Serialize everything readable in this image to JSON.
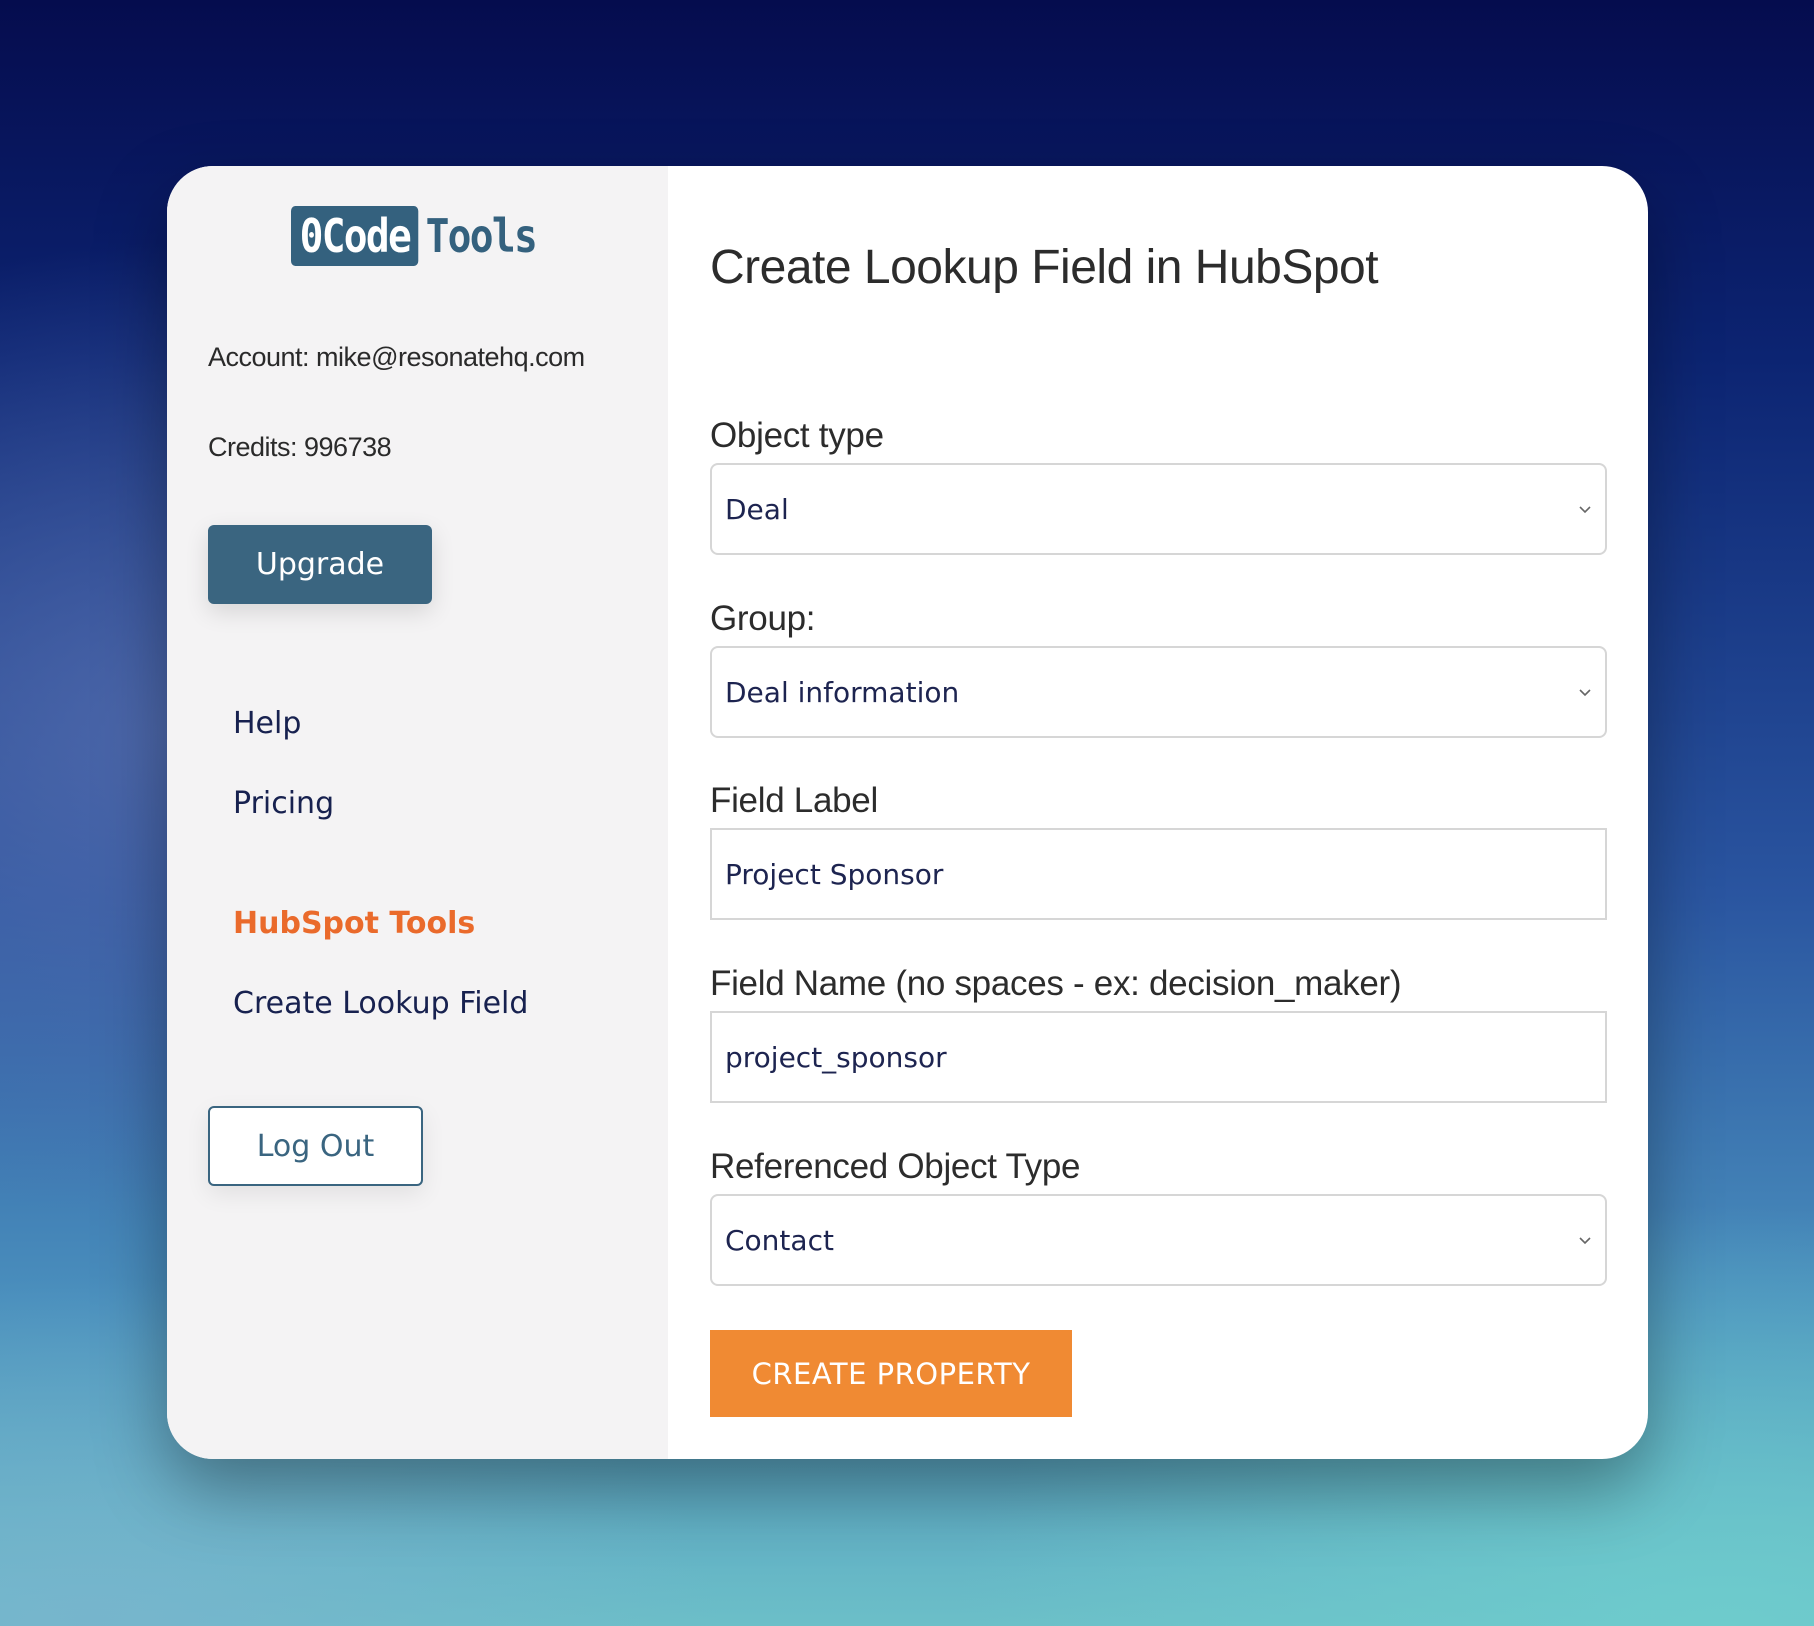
{
  "sidebar": {
    "logo": {
      "box_text": "0Code",
      "text": "Tools",
      "color": "#34617e"
    },
    "account": "Account: mike@resonatehq.com",
    "credits": "Credits: 996738",
    "upgrade_label": "Upgrade",
    "nav": {
      "help": "Help",
      "pricing": "Pricing",
      "section_title": "HubSpot Tools",
      "create_lookup": "Create Lookup Field"
    },
    "logout_label": "Log Out"
  },
  "main": {
    "title": "Create Lookup Field in HubSpot",
    "fields": {
      "object_type": {
        "label": "Object type",
        "value": "Deal"
      },
      "group": {
        "label": "Group:",
        "value": "Deal information"
      },
      "field_label": {
        "label": "Field Label",
        "value": "Project Sponsor"
      },
      "field_name": {
        "label": "Field Name (no spaces - ex: decision_maker)",
        "value": "project_sponsor"
      },
      "referenced_object_type": {
        "label": "Referenced Object Type",
        "value": "Contact"
      }
    },
    "submit_label": "CREATE PROPERTY"
  },
  "colors": {
    "accent_orange": "#f08a33",
    "section_orange": "#ea6a2b",
    "primary_blue": "#3a6580",
    "nav_text": "#17214f"
  }
}
